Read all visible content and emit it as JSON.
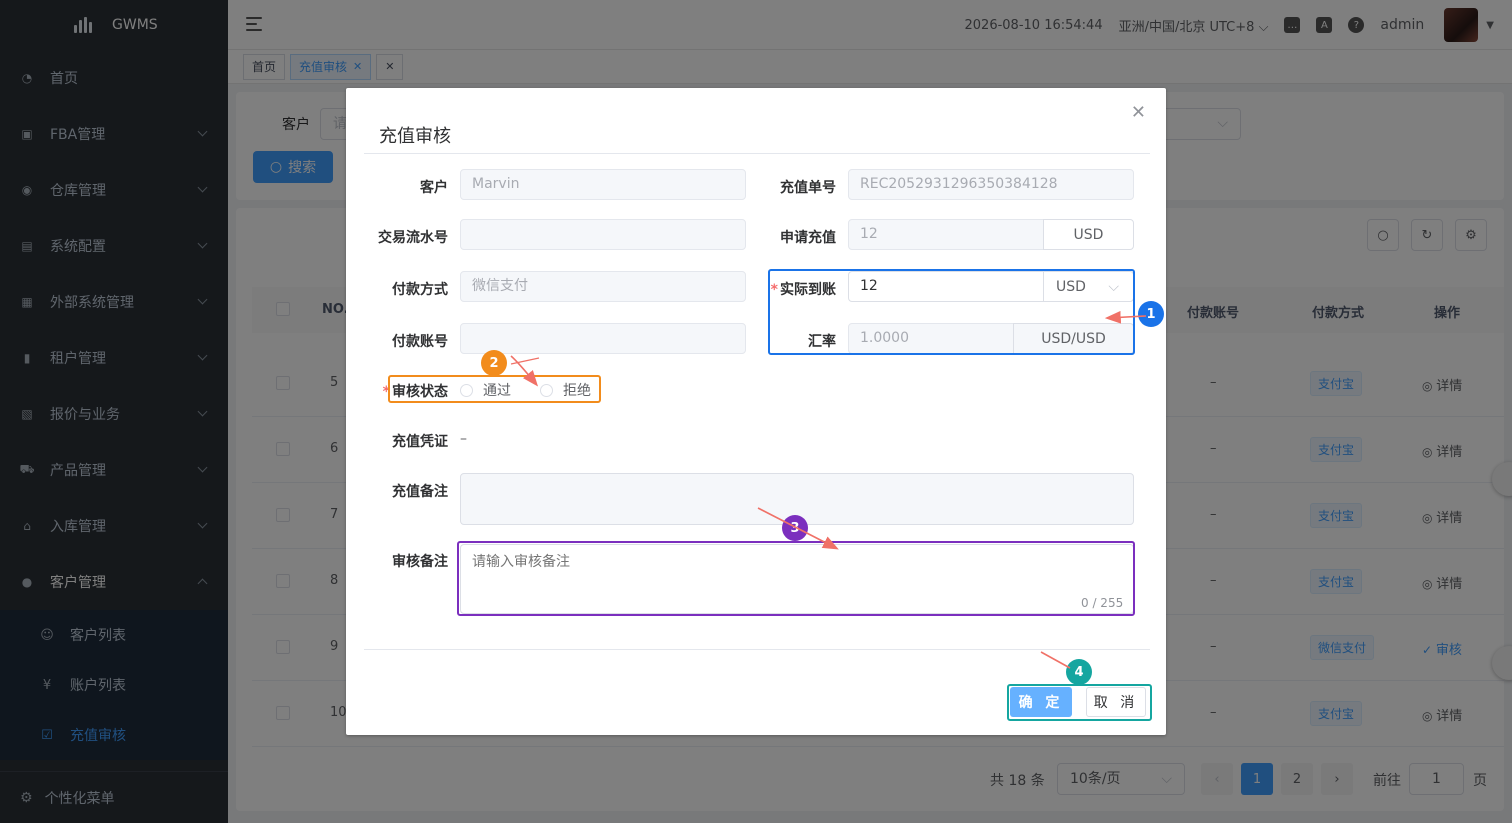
{
  "app": {
    "name": "GWMS"
  },
  "sidebar": {
    "items": [
      {
        "label": "首页",
        "icon": "dashboard-icon"
      },
      {
        "label": "FBA管理",
        "icon": "box-icon"
      },
      {
        "label": "仓库管理",
        "icon": "globe-icon"
      },
      {
        "label": "系统配置",
        "icon": "document-icon"
      },
      {
        "label": "外部系统管理",
        "icon": "grid-icon"
      },
      {
        "label": "租户管理",
        "icon": "bar-chart-icon"
      },
      {
        "label": "报价与业务",
        "icon": "file-icon"
      },
      {
        "label": "产品管理",
        "icon": "cart-icon"
      },
      {
        "label": "入库管理",
        "icon": "home-icon"
      },
      {
        "label": "客户管理",
        "icon": "user-icon"
      }
    ],
    "sub_items": [
      {
        "label": "客户列表",
        "icon": "customer-icon"
      },
      {
        "label": "账户列表",
        "icon": "yen-icon"
      },
      {
        "label": "充值审核",
        "icon": "checkbox-icon"
      }
    ],
    "custom_menu": "个性化菜单"
  },
  "header": {
    "datetime": "2026-08-10 16:54:44",
    "timezone": "亚洲/中国/北京 UTC+8",
    "user": "admin"
  },
  "tags": {
    "home": "首页",
    "current": "充值审核"
  },
  "search": {
    "customer_label": "客户",
    "customer_placeholder": "请",
    "search_button": "搜索"
  },
  "table": {
    "columns": {
      "no": "NO.",
      "pay_account": "付款账号",
      "pay_method": "付款方式",
      "action": "操作"
    },
    "rows": [
      {
        "no": "5",
        "account": "–",
        "method": "支付宝",
        "action": "详情"
      },
      {
        "no": "6",
        "account": "–",
        "method": "支付宝",
        "action": "详情"
      },
      {
        "no": "7",
        "account": "–",
        "method": "支付宝",
        "action": "详情"
      },
      {
        "no": "8",
        "account": "–",
        "method": "支付宝",
        "action": "详情"
      },
      {
        "no": "9",
        "account": "–",
        "method": "微信支付",
        "action": "审核"
      },
      {
        "no": "10",
        "account": "–",
        "method": "支付宝",
        "action": "详情"
      }
    ]
  },
  "pagination": {
    "total": "共 18 条",
    "page_size": "10条/页",
    "page1": "1",
    "page2": "2",
    "goto": "前往",
    "goto_value": "1",
    "page_unit": "页"
  },
  "dialog": {
    "title": "充值审核",
    "customer_label": "客户",
    "customer_value": "Marvin",
    "order_label": "充值单号",
    "order_value": "REC2052931296350384128",
    "txn_label": "交易流水号",
    "apply_label": "申请充值",
    "apply_value": "12",
    "apply_currency": "USD",
    "pay_method_label": "付款方式",
    "pay_method_value": "微信支付",
    "actual_label": "实际到账",
    "actual_value": "12",
    "actual_currency": "USD",
    "pay_account_label": "付款账号",
    "rate_label": "汇率",
    "rate_value": "1.0000",
    "rate_pair": "USD/USD",
    "status_label": "审核状态",
    "status_pass": "通过",
    "status_reject": "拒绝",
    "voucher_label": "充值凭证",
    "voucher_value": "–",
    "remark_label": "充值备注",
    "audit_remark_label": "审核备注",
    "audit_remark_placeholder": "请输入审核备注",
    "audit_remark_count": "0 / 255",
    "confirm": "确 定",
    "cancel": "取 消"
  },
  "annotations": {
    "badge1": "1",
    "badge2": "2",
    "badge3": "3",
    "badge4": "4",
    "color_blue": "#1a73e8",
    "color_orange": "#f28c1c",
    "color_purple": "#7b2fbe",
    "color_teal": "#15a6a0"
  }
}
